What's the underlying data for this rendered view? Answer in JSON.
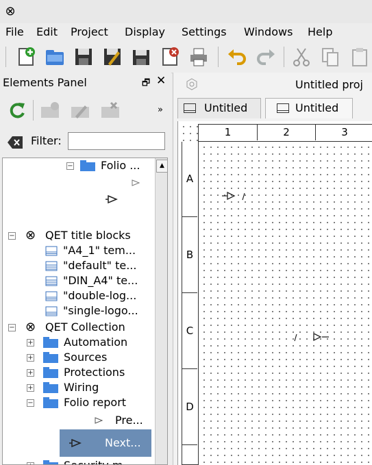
{
  "menu": [
    "File",
    "Edit",
    "Project",
    "Display",
    "Settings",
    "Windows",
    "Help"
  ],
  "panel": {
    "title": "Elements Panel",
    "filter_label": "Filter:",
    "filter_value": ""
  },
  "tree": {
    "folio_top": "Folio ...",
    "titleblocks": "QET title blocks",
    "tb_items": [
      "\"A4_1\" tem...",
      "\"default\" te...",
      "\"DIN_A4\" te...",
      "\"double-log...",
      "\"single-logo..."
    ],
    "collection": "QET Collection",
    "folders": [
      "Automation",
      "Sources",
      "Protections",
      "Wiring",
      "Folio report"
    ],
    "prev_item": "Pre...",
    "next_item": "Next...",
    "security": "Security m..."
  },
  "project": {
    "title": "Untitled proj",
    "tabs": [
      "Untitled",
      "Untitled"
    ]
  },
  "sheet": {
    "columns": [
      "1",
      "2",
      "3"
    ],
    "rows": [
      "A",
      "B",
      "C",
      "D"
    ]
  }
}
